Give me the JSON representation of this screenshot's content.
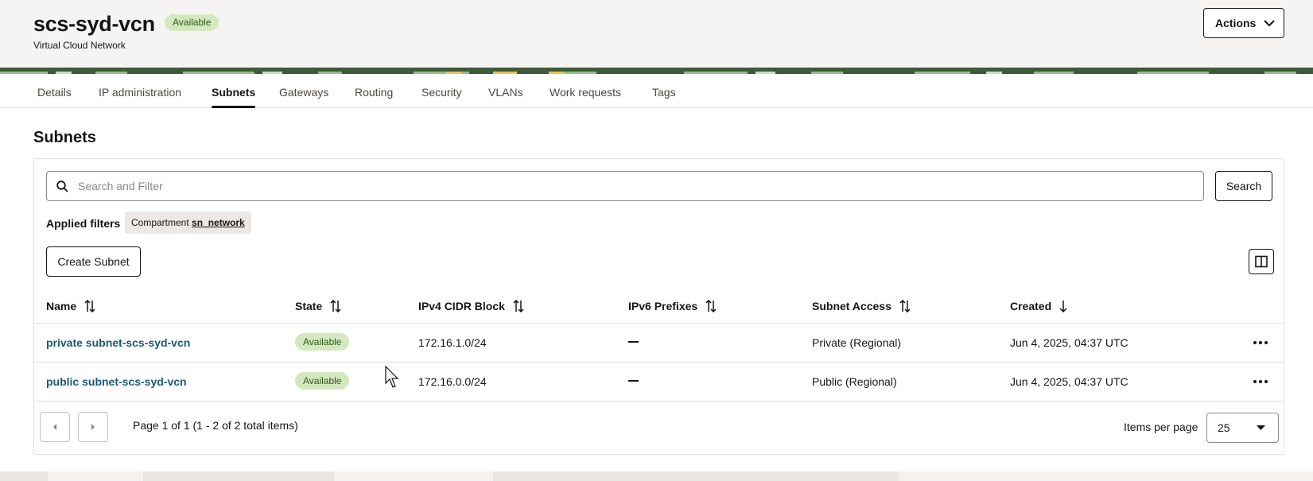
{
  "header": {
    "title": "scs-syd-vcn",
    "status": "Available",
    "subtitle": "Virtual Cloud Network",
    "actions_label": "Actions"
  },
  "tabs": [
    {
      "label": "Details"
    },
    {
      "label": "IP administration"
    },
    {
      "label": "Subnets",
      "active": true
    },
    {
      "label": "Gateways"
    },
    {
      "label": "Routing"
    },
    {
      "label": "Security"
    },
    {
      "label": "VLANs"
    },
    {
      "label": "Work requests"
    },
    {
      "label": "Tags"
    }
  ],
  "section": {
    "title": "Subnets"
  },
  "search": {
    "placeholder": "Search and Filter",
    "button_label": "Search"
  },
  "filters": {
    "label": "Applied filters",
    "chip_key": "Compartment",
    "chip_value": "sn_network"
  },
  "toolbar": {
    "create_label": "Create Subnet"
  },
  "table": {
    "columns": [
      "Name",
      "State",
      "IPv4 CIDR Block",
      "IPv6 Prefixes",
      "Subnet Access",
      "Created"
    ],
    "rows": [
      {
        "name": "private subnet-scs-syd-vcn",
        "state": "Available",
        "ipv4": "172.16.1.0/24",
        "ipv6": "—",
        "access": "Private (Regional)",
        "created": "Jun 4, 2025, 04:37 UTC"
      },
      {
        "name": "public subnet-scs-syd-vcn",
        "state": "Available",
        "ipv4": "172.16.0.0/24",
        "ipv6": "—",
        "access": "Public (Regional)",
        "created": "Jun 4, 2025, 04:37 UTC"
      }
    ]
  },
  "pagination": {
    "info": "Page 1 of 1 (1 - 2 of 2 total items)",
    "items_per_page_label": "Items per page",
    "items_per_page_value": "25"
  },
  "colors": {
    "status_bg": "#d4e8c0",
    "status_text": "#2d5a16",
    "link": "#1a5a7a"
  }
}
